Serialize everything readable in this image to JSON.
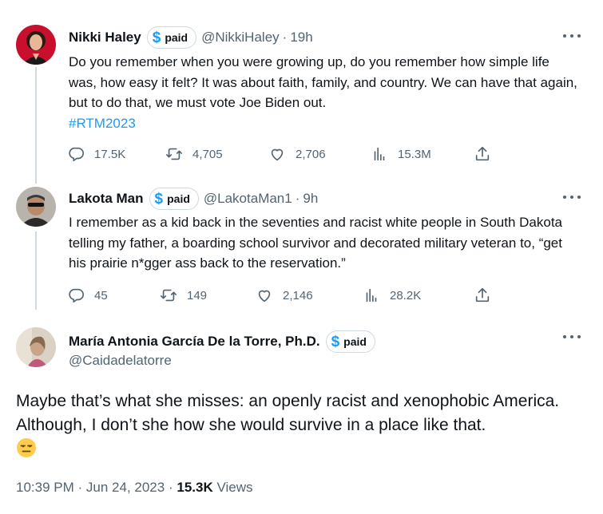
{
  "colors": {
    "accent": "#1d9bf0",
    "text": "#0f1419",
    "muted": "#536471",
    "border": "#cfd9de"
  },
  "icons": [
    "reply-icon",
    "retweet-icon",
    "like-icon",
    "views-icon",
    "share-icon",
    "more-icon",
    "paid-dollar-icon",
    "unamused-emoji"
  ],
  "tweets": [
    {
      "name": "Nikki Haley",
      "badge": "paid",
      "badge_symbol": "$",
      "handle": "@NikkiHaley",
      "separator": "·",
      "time": "19h",
      "text": "Do you remember when you were growing up, do you remember how simple life was, how easy it felt? It was about faith, family, and country. We can have that again, but to do that, we must vote Joe Biden out.",
      "hashtag": "#RTM2023",
      "replies": "17.5K",
      "retweets": "4,705",
      "likes": "2,706",
      "views": "15.3M"
    },
    {
      "name": "Lakota Man",
      "badge": "paid",
      "badge_symbol": "$",
      "handle": "@LakotaMan1",
      "separator": "·",
      "time": "9h",
      "text": "I remember as a kid back in the seventies and racist white people in South Dakota telling my father, a boarding school survivor and decorated military veteran to, “get his prairie n*gger ass back to the reservation.”",
      "replies": "45",
      "retweets": "149",
      "likes": "2,146",
      "views": "28.2K"
    }
  ],
  "main": {
    "name": "María Antonia García De la Torre, Ph.D.",
    "badge": "paid",
    "badge_symbol": "$",
    "handle": "@Caidadelatorre",
    "text": "Maybe that’s what she misses: an openly racist and xenophobic America. Although, I don’t she how she would survive in a place like that.",
    "time": "10:39 PM",
    "separator": "·",
    "date": "Jun 24, 2023",
    "views_count": "15.3K",
    "views_label": "Views"
  }
}
